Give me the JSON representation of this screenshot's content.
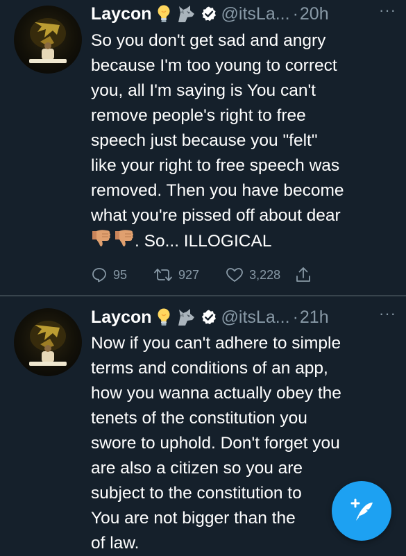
{
  "tweets": [
    {
      "author_name": "Laycon",
      "badges": [
        "lightbulb-emoji",
        "wolf-emoji",
        "verified-icon"
      ],
      "handle": "@itsLa...",
      "separator": "·",
      "time": "20h",
      "more": "···",
      "lines": [
        "So you don't get sad and angry",
        "because I'm too young to correct",
        "you, all I'm saying is You can't",
        "remove people's right to free",
        "speech just because you \"felt\"",
        "like your right to free speech was",
        "removed. Then you have become",
        "what you're pissed off about dear"
      ],
      "last_line_text": ". So... ILLOGICAL",
      "last_line_emojis": [
        "thumbs-down-emoji",
        "thumbs-down-emoji"
      ],
      "stats": {
        "replies": "95",
        "retweets": "927",
        "likes": "3,228"
      }
    },
    {
      "author_name": "Laycon",
      "badges": [
        "lightbulb-emoji",
        "wolf-emoji",
        "verified-icon"
      ],
      "handle": "@itsLa...",
      "separator": "·",
      "time": "21h",
      "more": "···",
      "lines": [
        "Now if you can't adhere to simple",
        "terms and conditions of an app,",
        "how you wanna actually obey the",
        "tenets of the constitution you",
        "swore to uphold. Don't forget you",
        "are also a citizen so you are",
        "subject to the constitution to",
        "You are not bigger than the",
        "of law."
      ]
    }
  ],
  "fab": {
    "icon": "compose-tweet-icon",
    "color": "#1da1f2"
  },
  "colors": {
    "background": "#15202b",
    "secondary_text": "#8899a6",
    "divider": "#38444d"
  }
}
